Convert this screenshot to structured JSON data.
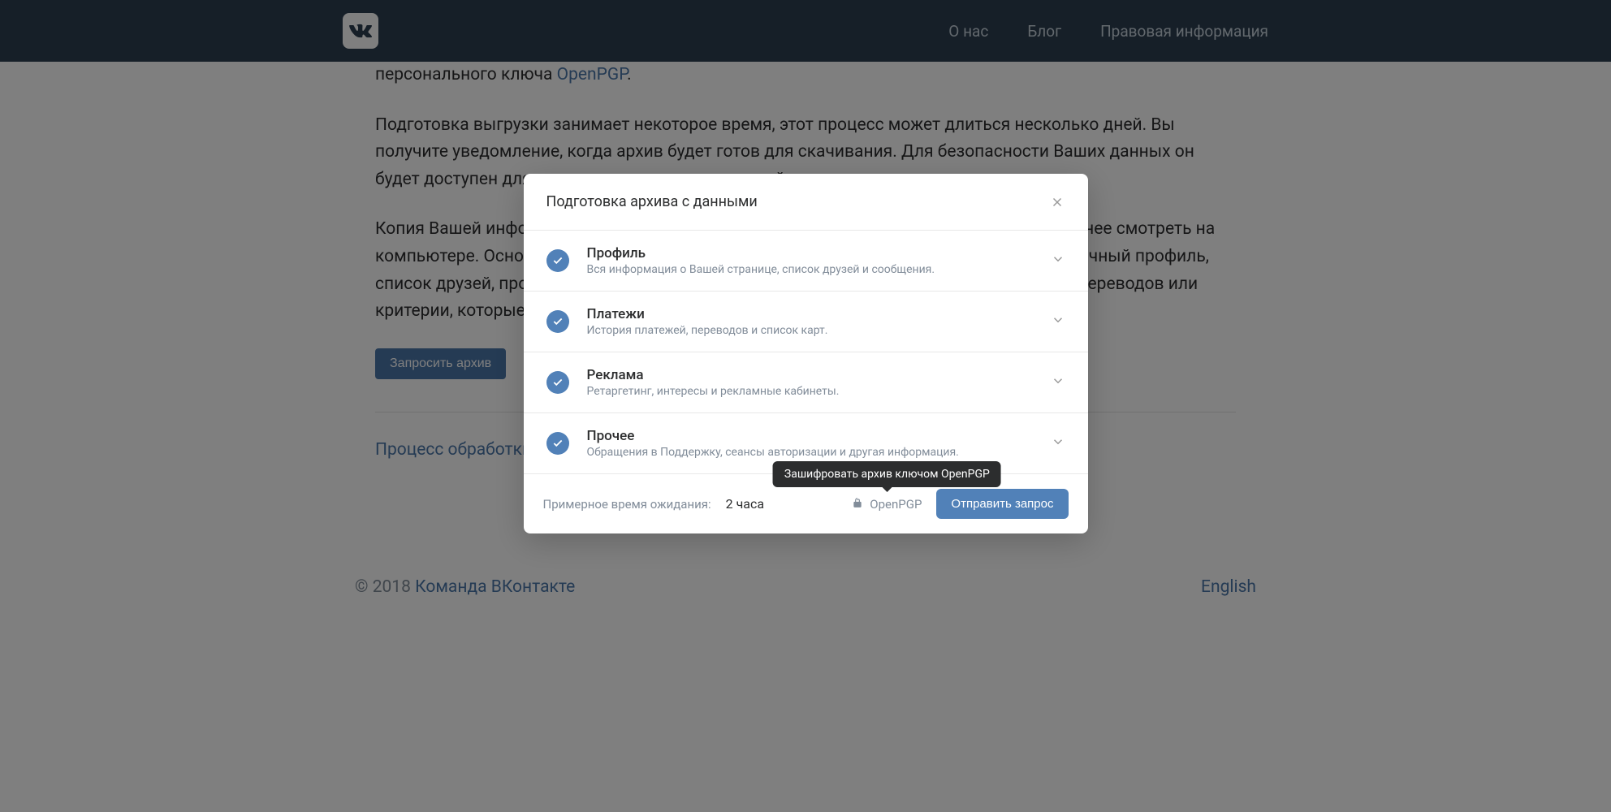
{
  "header": {
    "nav": {
      "about": "О нас",
      "blog": "Блог",
      "legal": "Правовая информация"
    }
  },
  "content": {
    "line1_prefix": "персонального ключа ",
    "line1_link": "OpenPGP",
    "line1_suffix": ".",
    "para2": "Подготовка выгрузки занимает некоторое время, этот процесс может длиться несколько дней. Вы получите уведомление, когда архив будет готов для скачивания. Для безопасности Ваших данных он будет доступен для загрузки лишь несколько дней.",
    "para3": "Копия Вашей информации будет содержать веб-страницу, открыв которую данные удобнее смотреть на компьютере. Основные данные в архиве разделены на разные категории. Например, личный профиль, список друзей, профили которым Вы ставили отметку «Нравится», историю денежных переводов или критерии, которые учитываются при таргетинге рекламных объявлений.",
    "request_btn": "Запросить архив",
    "process_link": "Процесс обработки"
  },
  "footer": {
    "copyright_prefix": "© 2018 ",
    "team_link": "Команда ВКонтакте",
    "language": "English"
  },
  "modal": {
    "title": "Подготовка архива с данными",
    "items": [
      {
        "title": "Профиль",
        "desc": "Вся информация о Вашей странице, список друзей и сообщения."
      },
      {
        "title": "Платежи",
        "desc": "История платежей, переводов и список карт."
      },
      {
        "title": "Реклама",
        "desc": "Ретаргетинг, интересы и рекламные кабинеты."
      },
      {
        "title": "Прочее",
        "desc": "Обращения в Поддержку, сеансы авторизации и другая информация."
      }
    ],
    "wait_label": "Примерное время ожидания:",
    "wait_value": "2 часа",
    "openpgp": "OpenPGP",
    "tooltip": "Зашифровать архив ключом OpenPGP",
    "submit": "Отправить запрос"
  }
}
